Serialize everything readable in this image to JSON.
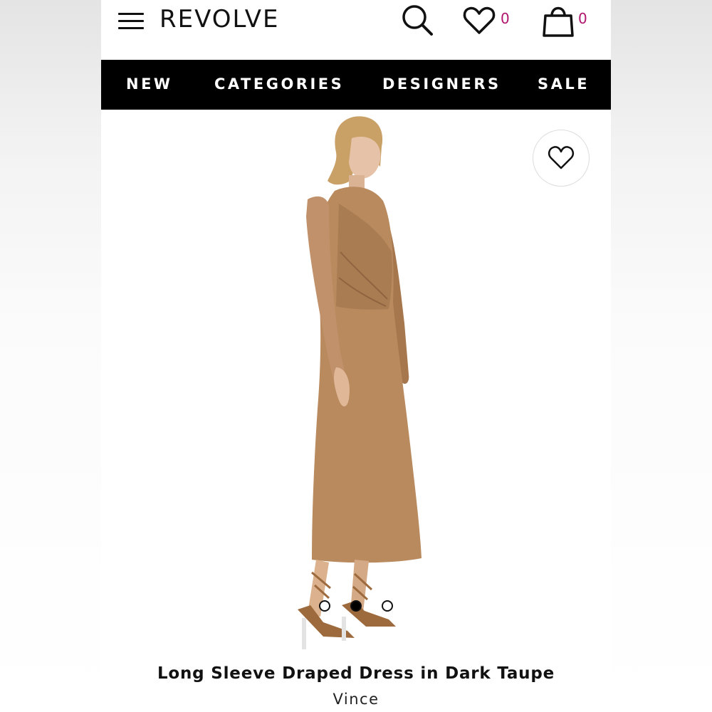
{
  "header": {
    "logo": "REVOLVE",
    "icons": {
      "menu": "hamburger-menu-icon",
      "search": "search-icon",
      "wishlist": "heart-icon",
      "bag": "shopping-bag-icon"
    },
    "wishlist_count": "0",
    "bag_count": "0",
    "count_color": "#b0156e"
  },
  "nav": {
    "items": [
      {
        "label": "NEW"
      },
      {
        "label": "CATEGORIES"
      },
      {
        "label": "DESIGNERS"
      },
      {
        "label": "SALE"
      }
    ],
    "background": "#000000"
  },
  "product": {
    "title": "Long Sleeve Draped Dress in Dark Taupe",
    "brand": "Vince",
    "dress_color": "#b98a5e",
    "image_count": 3,
    "active_image": 2
  }
}
